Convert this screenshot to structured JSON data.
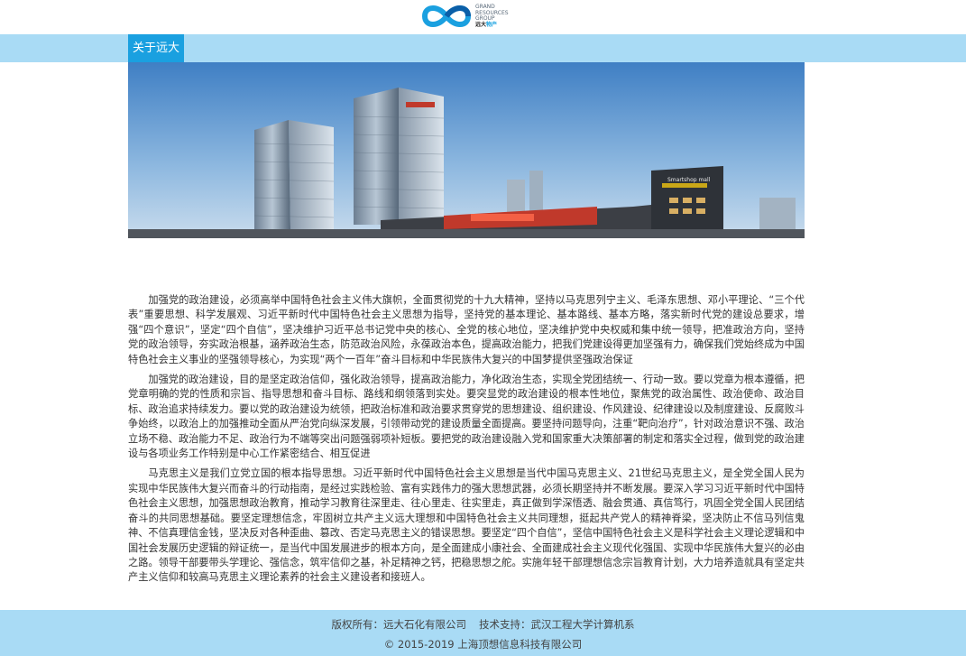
{
  "brand": {
    "name_lines": [
      "GRAND",
      "RESOURCES",
      "GROUP"
    ],
    "name_zh": "远大",
    "name_zh_accent": "物产",
    "accent_color": "#1aa0e0"
  },
  "nav": {
    "items": [
      {
        "label": "关于远大"
      }
    ]
  },
  "banner": {
    "icon": "building-photo",
    "sign_text": "Smartshop mall"
  },
  "article": {
    "paragraphs": [
      "加强党的政治建设，必须高举中国特色社会主义伟大旗帜，全面贯彻党的十九大精神，坚持以马克思列宁主义、毛泽东思想、邓小平理论、“三个代表”重要思想、科学发展观、习近平新时代中国特色社会主义思想为指导，坚持党的基本理论、基本路线、基本方略，落实新时代党的建设总要求，增强“四个意识”，坚定“四个自信”，坚决维护习近平总书记党中央的核心、全党的核心地位，坚决维护党中央权威和集中统一领导，把准政治方向，坚持党的政治领导，夯实政治根基，涵养政治生态，防范政治风险，永葆政治本色，提高政治能力，把我们党建设得更加坚强有力，确保我们党始终成为中国特色社会主义事业的坚强领导核心，为实现“两个一百年”奋斗目标和中华民族伟大复兴的中国梦提供坚强政治保证",
      "加强党的政治建设，目的是坚定政治信仰，强化政治领导，提高政治能力，净化政治生态，实现全党团结统一、行动一致。要以党章为根本遵循，把党章明确的党的性质和宗旨、指导思想和奋斗目标、路线和纲领落到实处。要突显党的政治建设的根本性地位，聚焦党的政治属性、政治使命、政治目标、政治追求持续发力。要以党的政治建设为统领，把政治标准和政治要求贯穿党的思想建设、组织建设、作风建设、纪律建设以及制度建设、反腐败斗争始终，以政治上的加强推动全面从严治党向纵深发展，引领带动党的建设质量全面提高。要坚持问题导向，注重“靶向治疗”，针对政治意识不强、政治立场不稳、政治能力不足、政治行为不端等突出问题强弱项补短板。要把党的政治建设融入党和国家重大决策部署的制定和落实全过程，做到党的政治建设与各项业务工作特别是中心工作紧密结合、相互促进",
      "马克思主义是我们立党立国的根本指导思想。习近平新时代中国特色社会主义思想是当代中国马克思主义、21世纪马克思主义，是全党全国人民为实现中华民族伟大复兴而奋斗的行动指南，是经过实践检验、富有实践伟力的强大思想武器，必须长期坚持并不断发展。要深入学习习近平新时代中国特色社会主义思想，加强思想政治教育，推动学习教育往深里走、往心里走、往实里走，真正做到学深悟透、融会贯通、真信笃行，巩固全党全国人民团结奋斗的共同思想基础。要坚定理想信念，牢固树立共产主义远大理想和中国特色社会主义共同理想，挺起共产党人的精神脊梁，坚决防止不信马列信鬼神、不信真理信金钱，坚决反对各种歪曲、篡改、否定马克思主义的错误思想。要坚定“四个自信”，坚信中国特色社会主义是科学社会主义理论逻辑和中国社会发展历史逻辑的辩证统一，是当代中国发展进步的根本方向，是全面建成小康社会、全面建成社会主义现代化强国、实现中华民族伟大复兴的必由之路。领导干部要带头学理论、强信念，筑牢信仰之基，补足精神之钙，把稳思想之舵。实施年轻干部理想信念宗旨教育计划，大力培养造就具有坚定共产主义信仰和较高马克思主义理论素养的社会主义建设者和接班人。"
    ]
  },
  "footer": {
    "copyright_label": "版权所有：远大石化有限公司",
    "support_label": "技术支持：武汉工程大学计算机系",
    "line2": "© 2015-2019 上海顶想信息科技有限公司"
  }
}
